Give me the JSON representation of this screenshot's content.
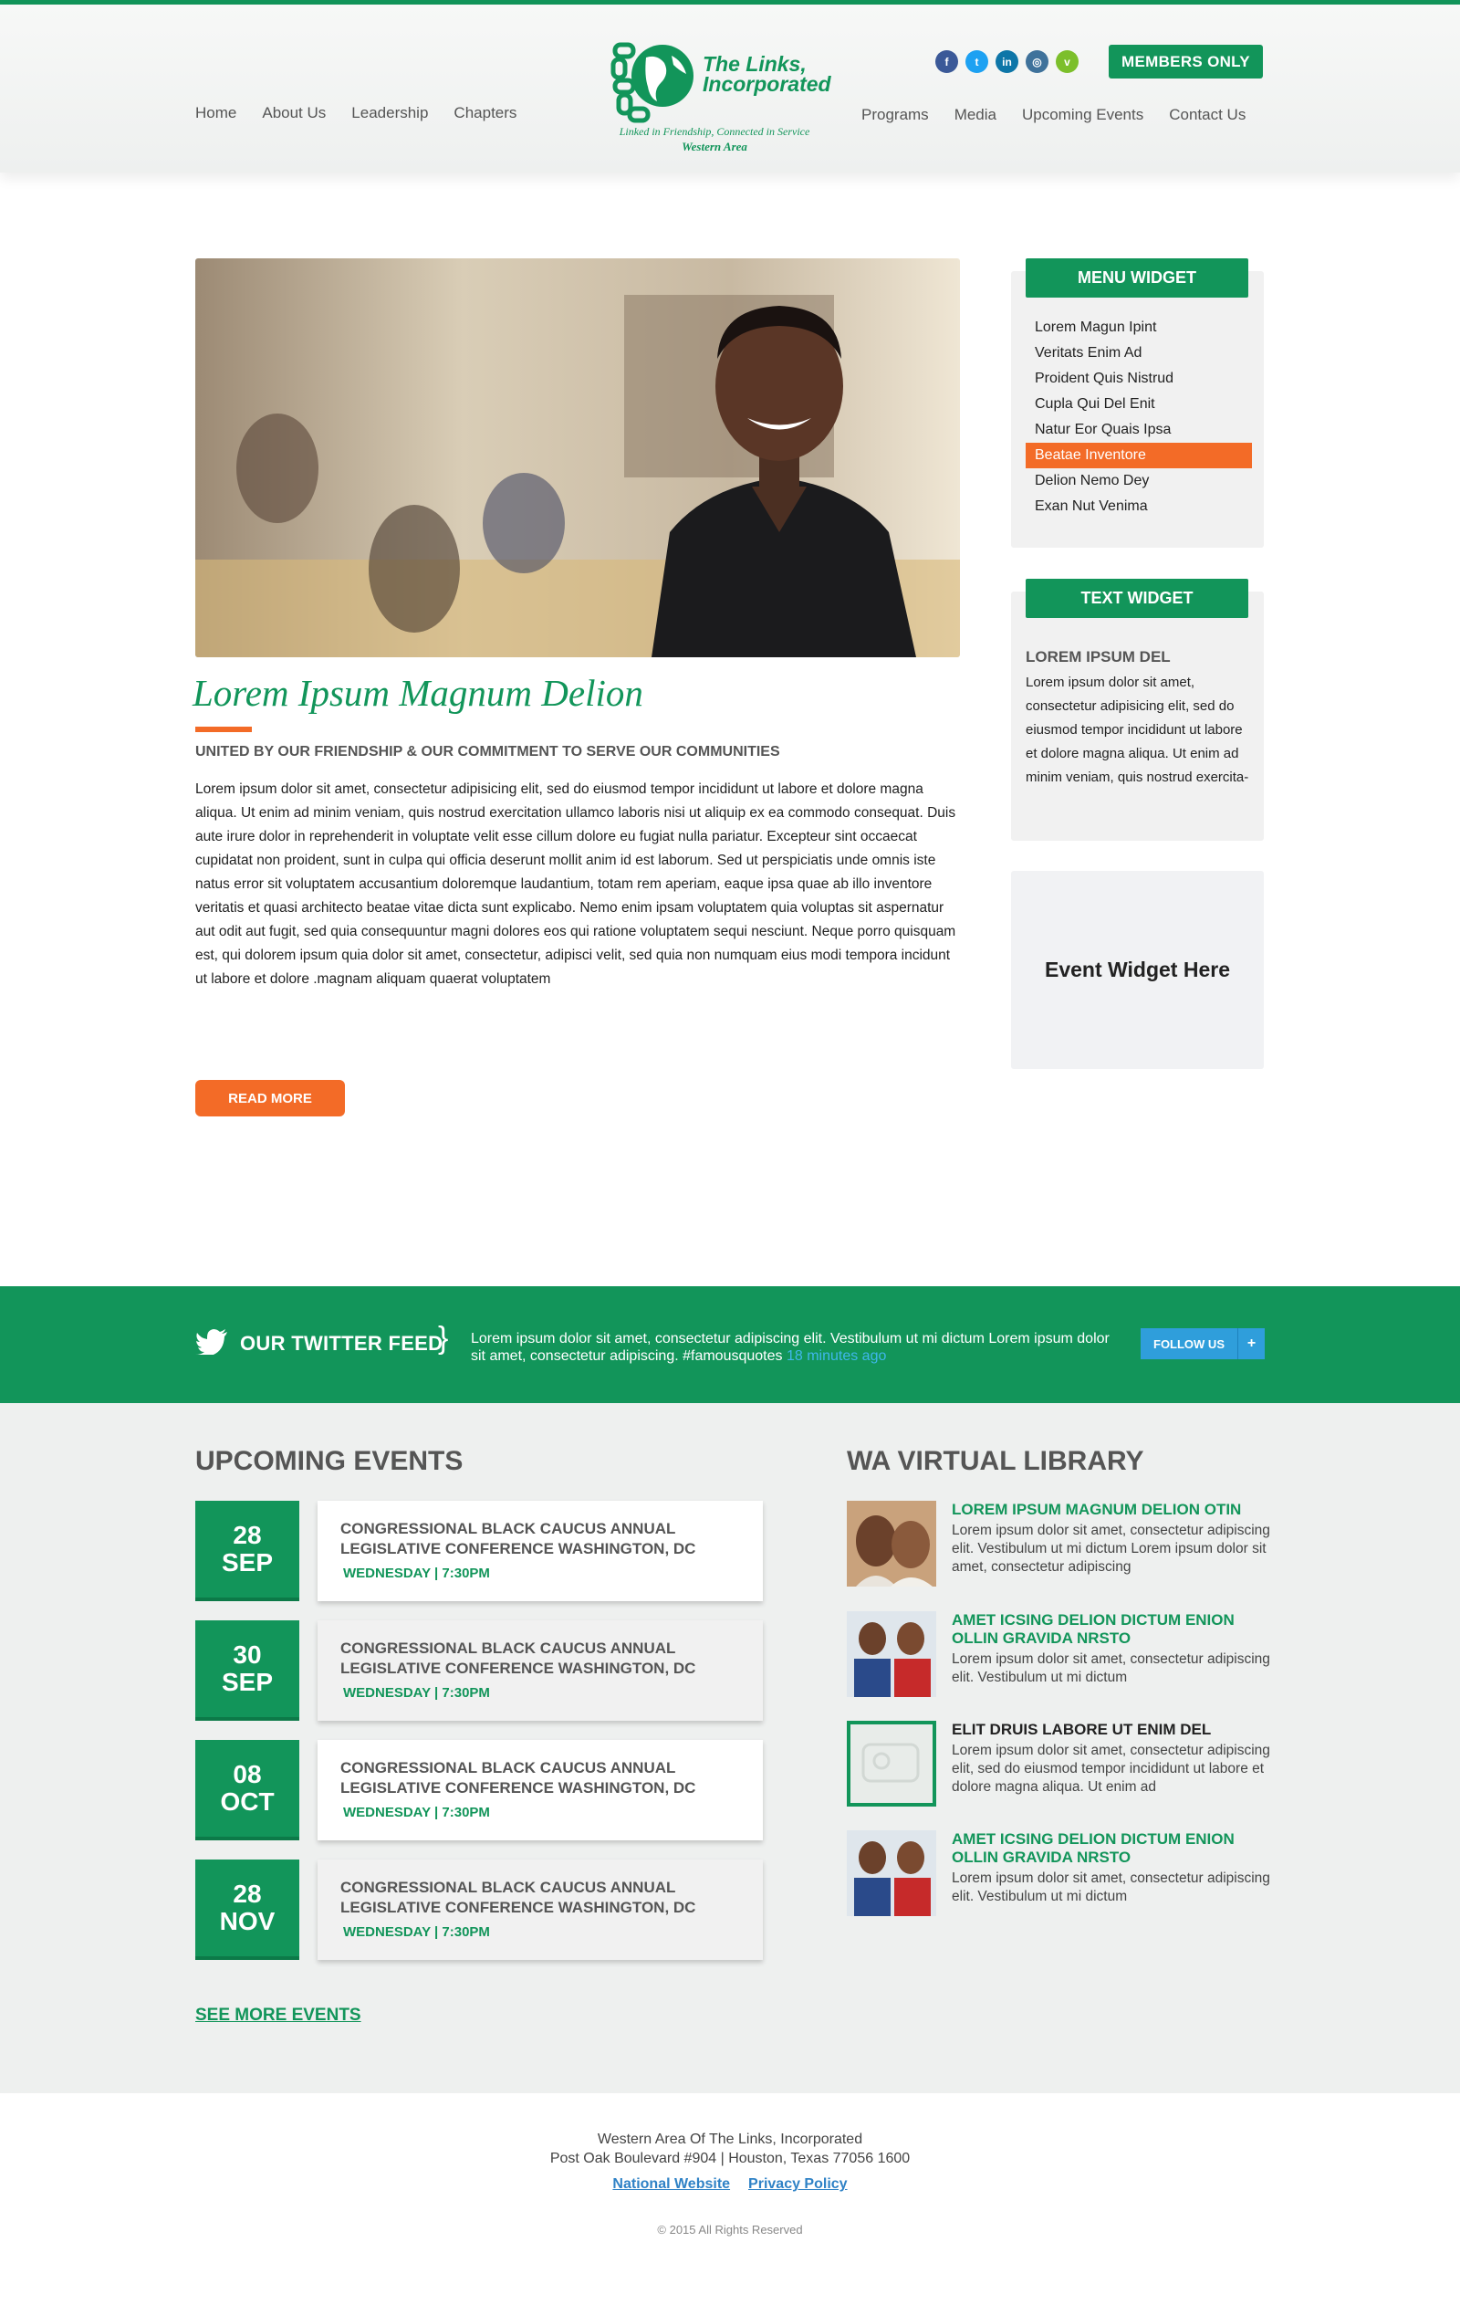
{
  "header": {
    "nav_left": [
      "Home",
      "About Us",
      "Leadership",
      "Chapters"
    ],
    "nav_right": [
      "Programs",
      "Media",
      "Upcoming Events",
      "Contact Us"
    ],
    "logo_name_line1": "The Links,",
    "logo_name_line2": "Incorporated",
    "logo_tagline": "Linked in Friendship, Connected in Service",
    "logo_area": "Western Area",
    "social": [
      {
        "icon": "facebook-icon",
        "glyph": "f",
        "color": "#3b5998"
      },
      {
        "icon": "twitter-icon",
        "glyph": "t",
        "color": "#1da1f2"
      },
      {
        "icon": "linkedin-icon",
        "glyph": "in",
        "color": "#0e76a8"
      },
      {
        "icon": "instagram-icon",
        "glyph": "◎",
        "color": "#3f729b"
      },
      {
        "icon": "vine-icon",
        "glyph": "v",
        "color": "#7cbf2b"
      }
    ],
    "members_label": "MEMBERS ONLY"
  },
  "article": {
    "title": "Lorem Ipsum Magnum Delion",
    "subtitle": "UNITED BY OUR FRIENDSHIP & OUR COMMITMENT TO SERVE OUR COMMUNITIES",
    "body": "Lorem ipsum dolor sit amet, consectetur adipisicing elit, sed do eiusmod tempor incididunt ut labore et dolore magna aliqua. Ut enim ad minim veniam, quis nostrud exercitation ullamco laboris nisi ut aliquip ex ea commodo consequat. Duis aute irure dolor in reprehenderit in voluptate velit esse cillum dolore eu fugiat nulla pariatur. Excepteur sint occaecat cupidatat non proident, sunt in culpa qui officia deserunt mollit anim id est laborum. Sed ut perspiciatis unde omnis iste natus error sit voluptatem accusantium doloremque laudantium, totam rem aperiam, eaque ipsa quae ab illo inventore veritatis et quasi architecto beatae vitae dicta sunt explicabo. Nemo enim ipsam voluptatem quia voluptas sit aspernatur aut odit aut fugit, sed quia consequuntur magni dolores eos qui ratione voluptatem sequi nesciunt. Neque porro quisquam est, qui dolorem ipsum quia dolor sit amet, consectetur, adipisci velit, sed quia non numquam eius modi tempora incidunt ut labore et dolore .magnam aliquam quaerat voluptatem",
    "read_more": "READ MORE"
  },
  "sidebar": {
    "menu_widget": {
      "title": "MENU WIDGET",
      "items": [
        {
          "label": "Lorem Magun Ipint"
        },
        {
          "label": "Veritats Enim Ad"
        },
        {
          "label": "Proident Quis Nistrud"
        },
        {
          "label": "Cupla Qui Del Enit"
        },
        {
          "label": "Natur Eor Quais Ipsa"
        },
        {
          "label": "Beatae Inventore",
          "active": true
        },
        {
          "label": "Delion Nemo Dey"
        },
        {
          "label": "Exan Nut Venima"
        }
      ]
    },
    "text_widget": {
      "title": "TEXT WIDGET",
      "heading": "LOREM IPSUM DEL",
      "body": "Lorem ipsum dolor sit amet, consectetur adipisicing elit, sed do eiusmod tempor incididunt ut labore et dolore magna aliqua. Ut enim ad minim veniam, quis nostrud exercita-"
    },
    "event_widget": {
      "label": "Event Widget Here"
    }
  },
  "twitter": {
    "title": "OUR TWITTER FEED",
    "brace": "}",
    "text": "Lorem ipsum dolor sit amet, consectetur adipiscing elit. Vestibulum ut mi dictum Lorem ipsum dolor sit amet, consectetur adipiscing. #famousquotes",
    "time": "18 minutes ago",
    "follow_label": "FOLLOW US",
    "follow_plus": "+"
  },
  "events": {
    "title": "UPCOMING EVENTS",
    "items": [
      {
        "day": "28",
        "month": "SEP",
        "title": "CONGRESSIONAL BLACK CAUCUS ANNUAL LEGISLATIVE CONFERENCE WASHINGTON, DC",
        "time": "WEDNESDAY | 7:30PM"
      },
      {
        "day": "30",
        "month": "SEP",
        "title": "CONGRESSIONAL BLACK CAUCUS ANNUAL LEGISLATIVE CONFERENCE WASHINGTON, DC",
        "time": "WEDNESDAY | 7:30PM"
      },
      {
        "day": "08",
        "month": "OCT",
        "title": "CONGRESSIONAL BLACK CAUCUS ANNUAL LEGISLATIVE CONFERENCE WASHINGTON, DC",
        "time": "WEDNESDAY | 7:30PM"
      },
      {
        "day": "28",
        "month": "NOV",
        "title": "CONGRESSIONAL BLACK CAUCUS ANNUAL LEGISLATIVE CONFERENCE WASHINGTON, DC",
        "time": "WEDNESDAY | 7:30PM"
      }
    ],
    "see_more": "SEE MORE EVENTS"
  },
  "library": {
    "title": "WA VIRTUAL LIBRARY",
    "items": [
      {
        "title": "LOREM IPSUM MAGNUM DELION OTIN",
        "body": "Lorem ipsum dolor sit amet, consectetur adipiscing elit. Vestibulum ut mi dictum Lorem ipsum dolor sit amet, consectetur adipiscing",
        "thumb": "two-women-photo"
      },
      {
        "title": "AMET ICSING DELION DICTUM ENION OLLIN GRAVIDA NRSTO",
        "body": "Lorem ipsum dolor sit amet, consectetur adipiscing elit. Vestibulum ut mi dictum",
        "thumb": "nurses-photo"
      },
      {
        "title": "ELIT DRUIS LABORE UT ENIM DEL",
        "body": "Lorem ipsum dolor sit amet, consectetur adipiscing elit, sed do eiusmod tempor incididunt ut labore et dolore magna aliqua. Ut enim ad",
        "thumb": "framed-placeholder"
      },
      {
        "title": "AMET ICSING DELION DICTUM ENION OLLIN GRAVIDA NRSTO",
        "body": "Lorem ipsum dolor sit amet, consectetur adipiscing elit. Vestibulum ut mi dictum",
        "thumb": "nurses-photo"
      }
    ]
  },
  "footer": {
    "line1": "Western Area Of The Links, Incorporated",
    "line2": "Post Oak Boulevard #904 | Houston, Texas 77056 1600",
    "links": [
      "National Website",
      "Privacy Policy"
    ],
    "copyright": "© 2015 All Rights Reserved"
  },
  "colors": {
    "brand_green": "#12955a",
    "accent_orange": "#f36b27",
    "twitter_blue": "#2f9edb"
  }
}
